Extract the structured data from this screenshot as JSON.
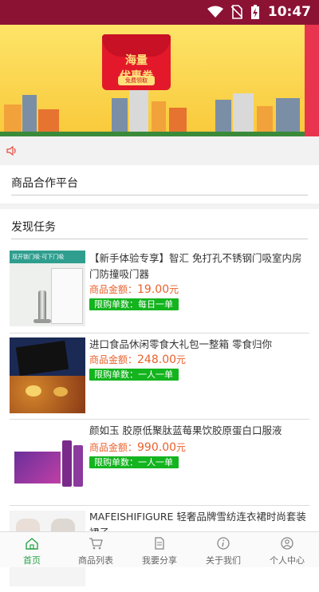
{
  "status": {
    "time": "10:47"
  },
  "banner": {
    "text_main": "海量",
    "text_sub": "优惠券",
    "text_btn": "免费领取"
  },
  "sections": {
    "platform_title": "商品合作平台",
    "tasks_title": "发现任务"
  },
  "products": [
    {
      "name": "【新手体验专享】智汇 免打孔不锈钢门吸室内房门防撞吸门器",
      "price_label": "商品金额：",
      "price": "19.00",
      "unit": "元",
      "limit": "限购单数：每日一单"
    },
    {
      "name": "进口食品休闲零食大礼包一整箱 零食归你",
      "price_label": "商品金额：",
      "price": "248.00",
      "unit": "元",
      "limit": "限购单数：一人一单"
    },
    {
      "name": "颜如玉 胶原低聚肽蓝莓果饮胶原蛋白口服液",
      "price_label": "商品金额：",
      "price": "990.00",
      "unit": "元",
      "limit": "限购单数：一人一单"
    },
    {
      "name": "MAFEISHIFIGURE 轻奢品牌雪纺连衣裙时尚套装裙子",
      "price_label": "",
      "price": "",
      "unit": "",
      "limit": ""
    }
  ],
  "thumb_texts": {
    "p1": "双开锁门吸·可下门吸"
  },
  "tabs": [
    {
      "label": "首页",
      "icon": "home-icon"
    },
    {
      "label": "商品列表",
      "icon": "cart-icon"
    },
    {
      "label": "我要分享",
      "icon": "share-doc-icon"
    },
    {
      "label": "关于我们",
      "icon": "info-icon"
    },
    {
      "label": "个人中心",
      "icon": "user-icon"
    }
  ],
  "colors": {
    "statusbar": "#8c1234",
    "accent_green": "#2aa34a",
    "tag_green": "#13b41e",
    "price_orange": "#e9612d"
  }
}
